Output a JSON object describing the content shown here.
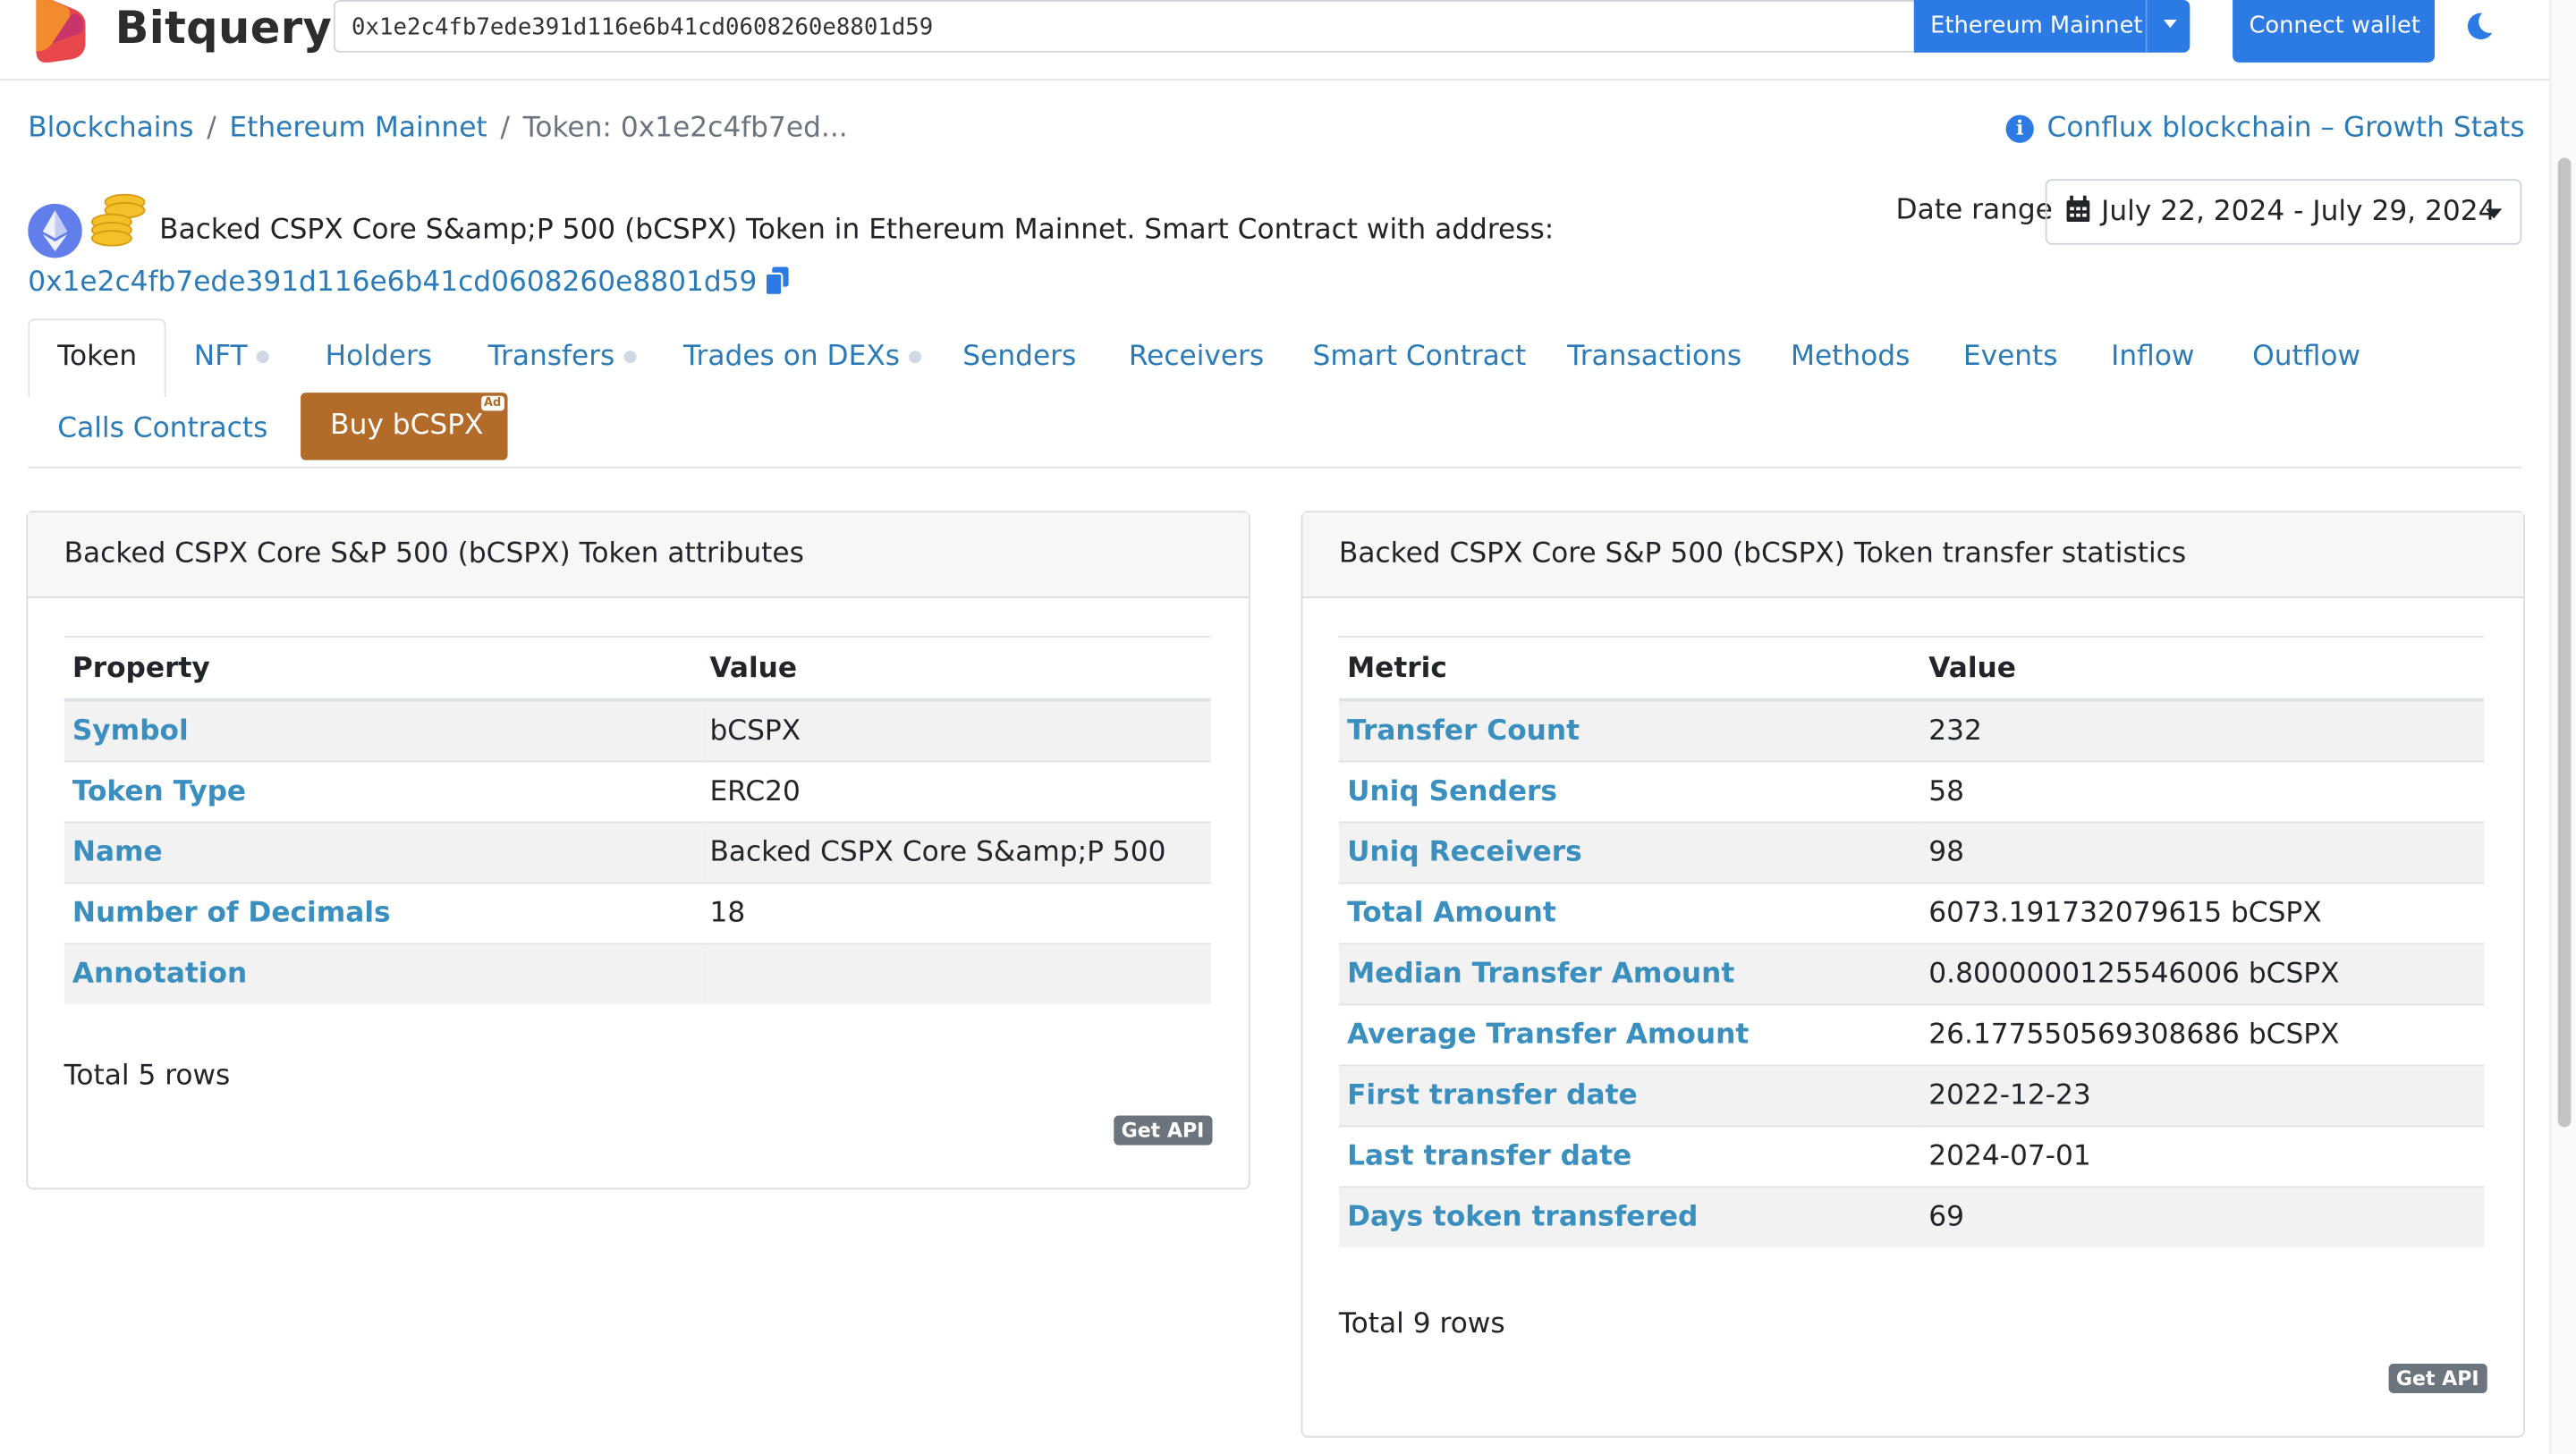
{
  "app": {
    "brand": "Bitquery",
    "search_value": "0x1e2c4fb7ede391d116e6b41cd0608260e8801d59",
    "network_button": "Ethereum Mainnet",
    "connect_wallet": "Connect wallet"
  },
  "breadcrumb": {
    "items": [
      "Blockchains",
      "Ethereum Mainnet"
    ],
    "current": "Token: 0x1e2c4fb7ed...",
    "separator": "/"
  },
  "promo_link": "Conflux blockchain – Growth Stats",
  "token": {
    "description": "Backed CSPX Core S&amp;P 500 (bCSPX) Token in Ethereum Mainnet. Smart Contract with address:",
    "address": "0x1e2c4fb7ede391d116e6b41cd0608260e8801d59"
  },
  "date_range": {
    "label": "Date range",
    "value": "July 22, 2024 - July 29, 2024"
  },
  "tabs": [
    {
      "label": "Token",
      "active": true
    },
    {
      "label": "NFT",
      "dot": true
    },
    {
      "label": "Holders"
    },
    {
      "label": "Transfers",
      "dot": true
    },
    {
      "label": "Trades on DEXs",
      "dot": true
    },
    {
      "label": "Senders"
    },
    {
      "label": "Receivers"
    },
    {
      "label": "Smart Contract"
    },
    {
      "label": "Transactions"
    },
    {
      "label": "Methods"
    },
    {
      "label": "Events"
    },
    {
      "label": "Inflow"
    },
    {
      "label": "Outflow"
    },
    {
      "label": "Calls Contracts"
    }
  ],
  "buy_button": {
    "label": "Buy bCSPX",
    "badge": "Ad"
  },
  "attributes_card": {
    "title": "Backed CSPX Core S&P 500 (bCSPX) Token attributes",
    "columns": [
      "Property",
      "Value"
    ],
    "rows": [
      [
        "Symbol",
        "bCSPX"
      ],
      [
        "Token Type",
        "ERC20"
      ],
      [
        "Name",
        "Backed CSPX Core S&amp;P 500"
      ],
      [
        "Number of Decimals",
        "18"
      ],
      [
        "Annotation",
        ""
      ]
    ],
    "total": "Total 5 rows",
    "api_label": "Get API"
  },
  "stats_card": {
    "title": "Backed CSPX Core S&P 500 (bCSPX) Token transfer statistics",
    "columns": [
      "Metric",
      "Value"
    ],
    "rows": [
      [
        "Transfer Count",
        "232"
      ],
      [
        "Uniq Senders",
        "58"
      ],
      [
        "Uniq Receivers",
        "98"
      ],
      [
        "Total Amount",
        "6073.191732079615 bCSPX"
      ],
      [
        "Median Transfer Amount",
        "0.8000000125546006 bCSPX"
      ],
      [
        "Average Transfer Amount",
        "26.177550569308686 bCSPX"
      ],
      [
        "First transfer date",
        "2022-12-23"
      ],
      [
        "Last transfer date",
        "2024-07-01"
      ],
      [
        "Days token transfered",
        "69"
      ]
    ],
    "total": "Total 9 rows",
    "api_label": "Get API"
  },
  "colors": {
    "link": "#2b7bb9",
    "primary_button": "#2c7be5",
    "buy_button": "#b36b2a",
    "row_stripe": "#f2f2f2"
  },
  "icons": [
    "bitquery-logo-icon",
    "moon-icon",
    "info-icon",
    "ethereum-icon",
    "coins-icon",
    "copy-icon",
    "calendar-icon",
    "chevron-down-icon"
  ]
}
